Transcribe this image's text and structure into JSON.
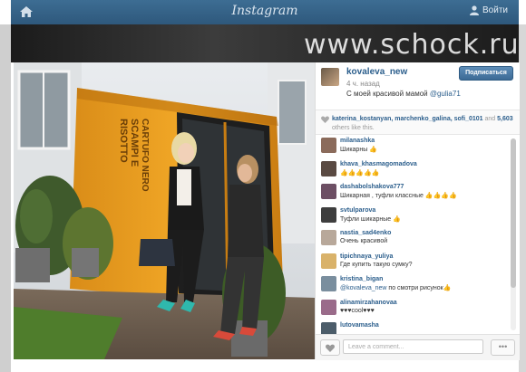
{
  "topbar": {
    "brand": "Instagram",
    "login": "Войти",
    "home_icon": "home-icon",
    "user_icon": "user-icon"
  },
  "watermark": "www.schock.ru",
  "post": {
    "username": "kovaleva_new",
    "follow_label": "Подписаться",
    "time": "4 ч. назад",
    "caption_text": "С моей красивой мамой",
    "caption_mention": "@gulia71"
  },
  "likes": {
    "users": "katerina_kostanyan, marchenko_galina, sofi_0101",
    "and": "and",
    "count": "5,603",
    "suffix": "others like this."
  },
  "comments": [
    {
      "user": "milanashka",
      "text": "Шикарны 👍"
    },
    {
      "user": "khava_khasmagomadova",
      "text": "👍👍👍👍👍"
    },
    {
      "user": "dashabolshakova777",
      "text": "Шикарная , туфли классные 👍👍👍👍"
    },
    {
      "user": "svtulparova",
      "text": "Туфли шикарные 👍"
    },
    {
      "user": "nastia_sad4enko",
      "text": "Очень красивой"
    },
    {
      "user": "tipichnaya_yuliya",
      "text": "Где купить такую сумку?"
    },
    {
      "user": "kristina_bigan",
      "text_mention": "@kovaleva_new",
      "text": "по смотри рисунок👍"
    },
    {
      "user": "alinamirzahanovaa",
      "text": "♥♥♥cool♥♥♥"
    },
    {
      "user": "lutovamasha",
      "text": ""
    }
  ],
  "footer": {
    "comment_placeholder": "Leave a comment...",
    "more_label": "•••"
  },
  "photo_signage": [
    "RISOTTO",
    "SCAMPI E",
    "CARTUFO NERO"
  ],
  "colors": {
    "topbar": "#3a6890",
    "accent": "#2b5e8c",
    "follow": "#4a79a5"
  }
}
